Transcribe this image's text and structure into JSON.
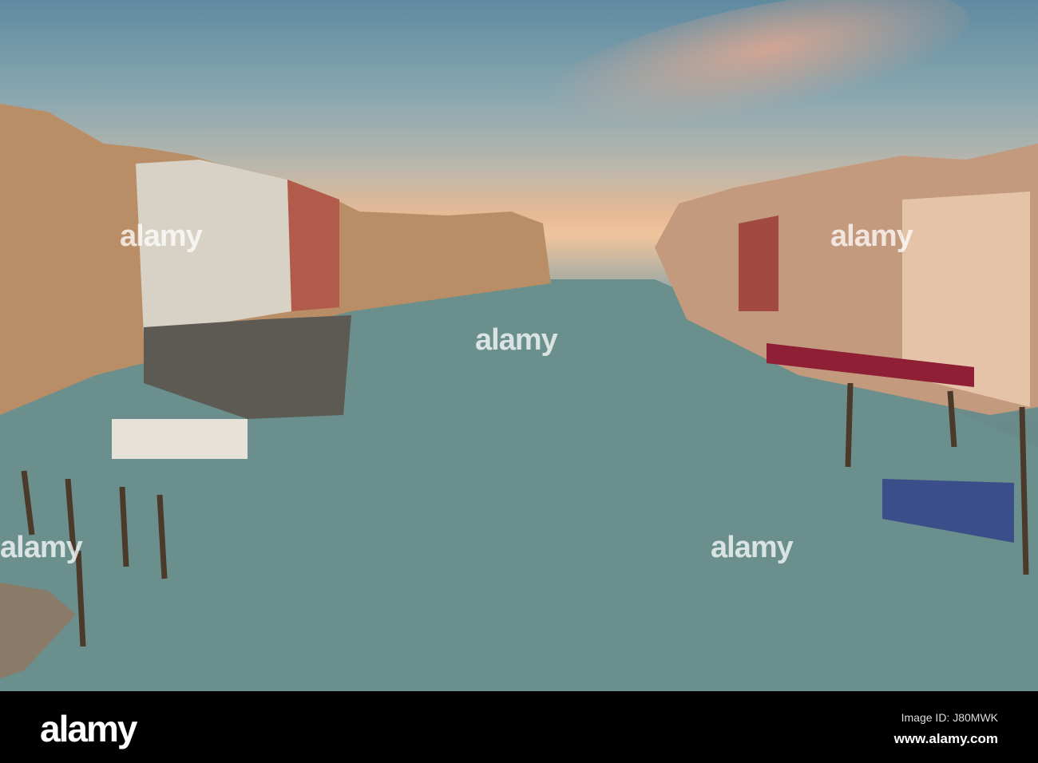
{
  "photo": {
    "subject": "Grand Canal from Rialto Bridge at sunset, Venice",
    "watermark": "alamy"
  },
  "footer": {
    "logo": "alamy",
    "image_id": "Image ID: J80MWK",
    "website": "www.alamy.com"
  }
}
